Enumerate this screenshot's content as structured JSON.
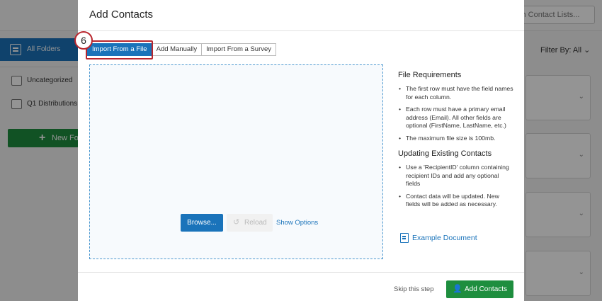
{
  "background": {
    "search_placeholder": "ch Contact Lists...",
    "sidebar": {
      "all_folders": "All Folders",
      "folders": [
        "Uncategorized",
        "Q1 Distributions"
      ],
      "new_folder": "New Fold"
    },
    "filter_label": "Filter By: All"
  },
  "modal": {
    "title": "Add Contacts",
    "step_badge": "6",
    "tabs": [
      "Import From a File",
      "Add Manually",
      "Import From a Survey"
    ],
    "active_tab": "Import From a File",
    "dropzone": {
      "browse_label": "Browse...",
      "reload_label": "Reload",
      "show_options_label": "Show Options"
    },
    "requirements": {
      "heading": "File Requirements",
      "items": [
        "The first row must have the field names for each column.",
        "Each row must have a primary email address (Email). All other fields are optional (FirstName, LastName, etc.)",
        "The maximum file size is 100mb."
      ]
    },
    "updating": {
      "heading": "Updating Existing Contacts",
      "items": [
        "Use a 'RecipientID' column containing recipient IDs and add any optional fields",
        "Contact data will be updated. New fields will be added as necessary."
      ]
    },
    "example_link": "Example Document",
    "footer": {
      "skip_label": "Skip this step",
      "add_label": "Add Contacts"
    }
  },
  "colors": {
    "primary_blue": "#1a73ba",
    "success_green": "#1e8e3e",
    "highlight_red": "#b8262e"
  }
}
